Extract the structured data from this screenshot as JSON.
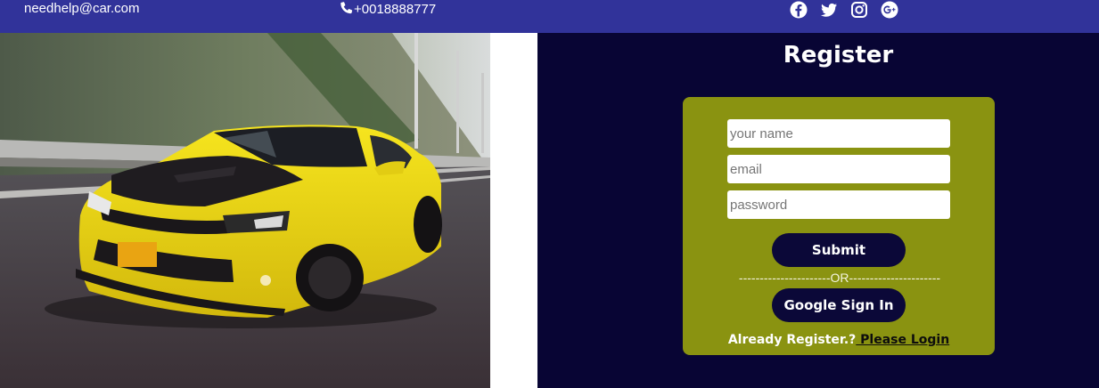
{
  "topbar": {
    "email": "needhelp@car.com",
    "phone": "+0018888777",
    "phone_icon": "phone-icon",
    "social_icons": [
      "facebook-icon",
      "twitter-icon",
      "instagram-icon",
      "google-plus-icon"
    ]
  },
  "hero": {
    "image": "yellow sports car on highway"
  },
  "register": {
    "title": "Register",
    "name_placeholder": "your name",
    "email_placeholder": "email",
    "password_placeholder": "password",
    "submit_label": "Submit",
    "or_divider": "----------------------OR----------------------",
    "google_label": "Google Sign In",
    "already_text": "Already Register.?",
    "login_link": " Please Login"
  },
  "colors": {
    "topbar": "#31339a",
    "panel": "#080534",
    "card": "#8a9311",
    "button": "#0b0838"
  }
}
